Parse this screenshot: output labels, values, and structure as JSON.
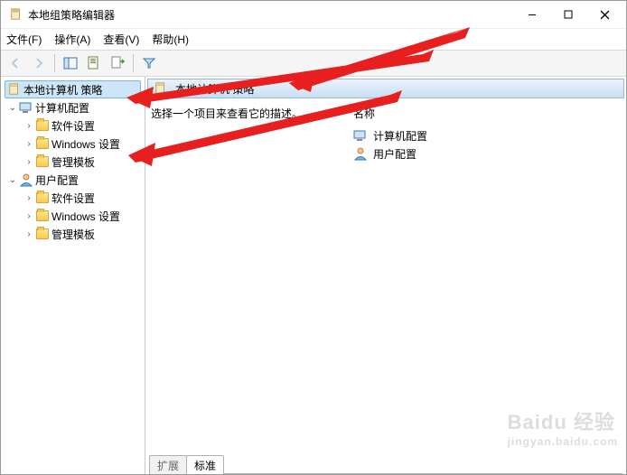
{
  "window": {
    "title": "本地组策略编辑器"
  },
  "menu": {
    "file": "文件(F)",
    "action": "操作(A)",
    "view": "查看(V)",
    "help": "帮助(H)"
  },
  "tree": {
    "root": "本地计算机 策略",
    "computer_config": "计算机配置",
    "cc_software": "软件设置",
    "cc_windows": "Windows 设置",
    "cc_admin": "管理模板",
    "user_config": "用户配置",
    "uc_software": "软件设置",
    "uc_windows": "Windows 设置",
    "uc_admin": "管理模板"
  },
  "detail": {
    "header": "本地计算机 策略",
    "instruction": "选择一个项目来查看它的描述。",
    "column_name": "名称",
    "items": {
      "computer_config": "计算机配置",
      "user_config": "用户配置"
    }
  },
  "tabs": {
    "extended": "扩展",
    "standard": "标准"
  },
  "watermark": {
    "line1": "Baidu 经验",
    "line2": "jingyan.baidu.com"
  }
}
